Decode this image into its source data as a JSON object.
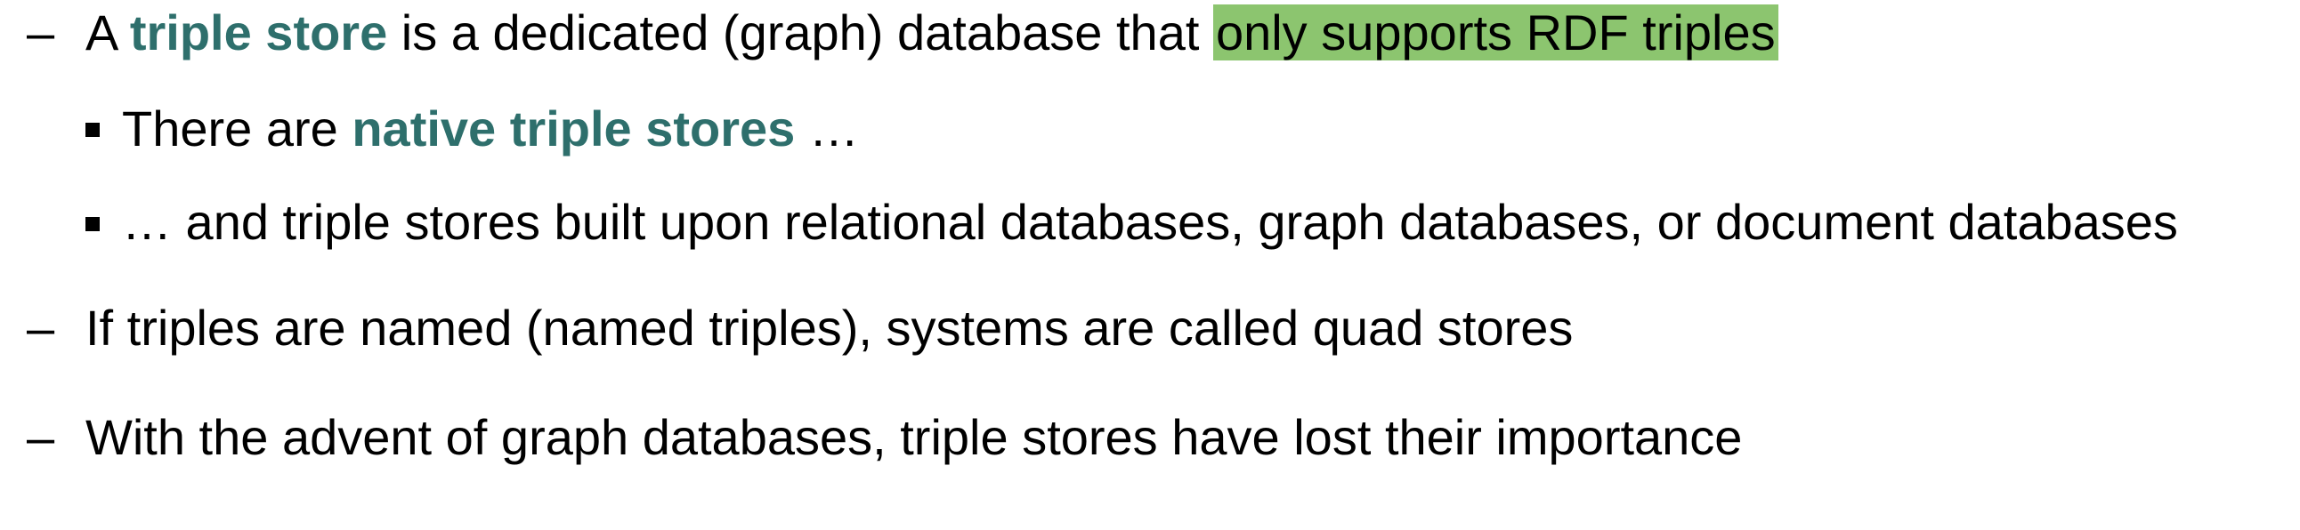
{
  "bullets": {
    "dash": "–",
    "item1": {
      "prefix": "A ",
      "keyword": "triple store",
      "middle": " is a dedicated (graph) database that ",
      "highlight": "only supports RDF triples"
    },
    "item1_sub1": {
      "prefix": "There are ",
      "keyword": "native triple stores",
      "suffix": " …"
    },
    "item1_sub2": {
      "text": "… and triple stores built upon relational databases, graph databases, or document databases"
    },
    "item2": {
      "text": "If triples are named (named triples), systems are called quad stores"
    },
    "item3": {
      "text": "With the advent of graph databases, triple stores have lost their importance"
    }
  },
  "colors": {
    "keyword": "#2e6f6c",
    "highlight": "#8cc56f"
  }
}
